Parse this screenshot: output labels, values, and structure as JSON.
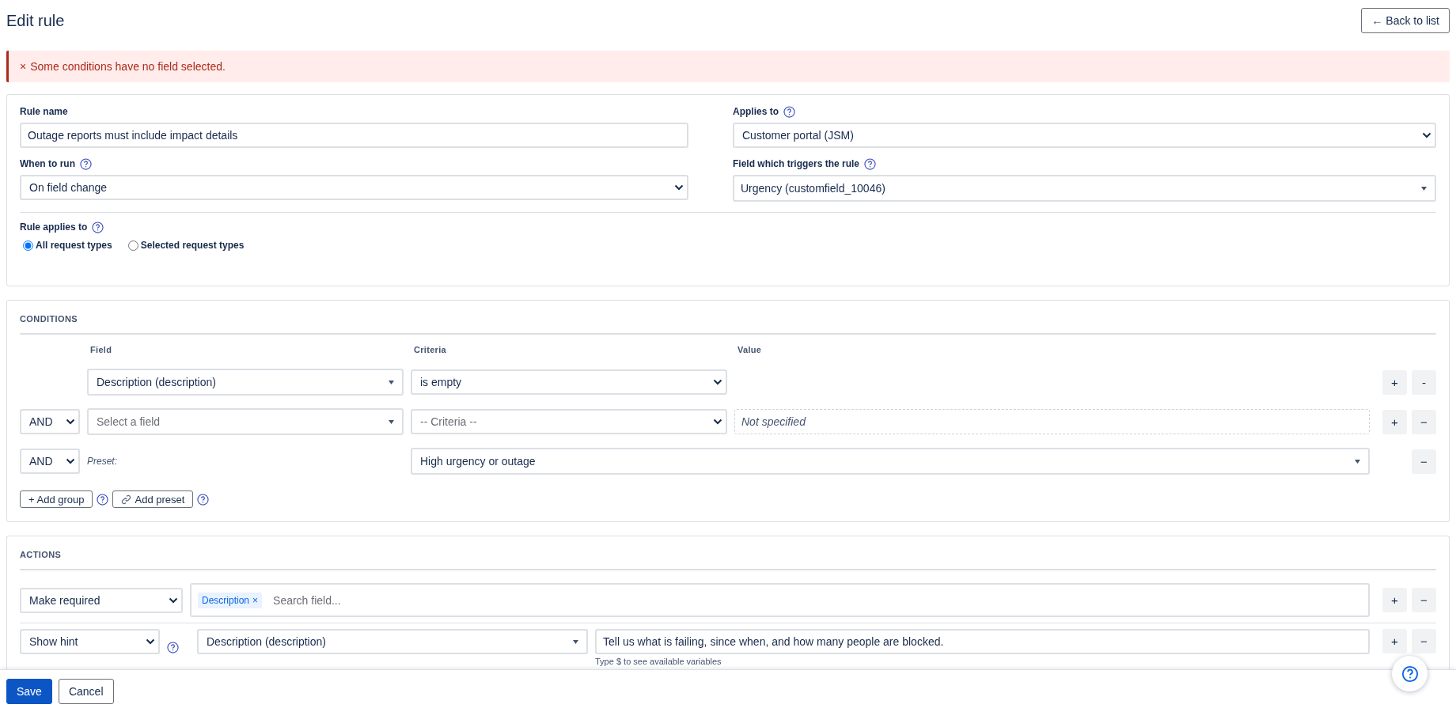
{
  "page": {
    "title": "Edit rule",
    "back_button": "← Back to list"
  },
  "error": {
    "icon": "×",
    "message": "Some conditions have no field selected."
  },
  "general": {
    "rule_name": {
      "label": "Rule name",
      "value": "Outage reports must include impact details"
    },
    "applies_to": {
      "label": "Applies to",
      "help": true,
      "kind": "select",
      "value": "Customer portal (JSM)"
    },
    "when_to_run": {
      "label": "When to run",
      "help": true,
      "kind": "select",
      "value": "On field change"
    },
    "trigger_field": {
      "label": "Field which triggers the rule",
      "help": true,
      "kind": "combo",
      "value": "Urgency (customfield_10046)"
    },
    "rule_applies_to": {
      "label": "Rule applies to",
      "help": true,
      "options": [
        {
          "label": "All request types",
          "selected": true
        },
        {
          "label": "Selected request types",
          "selected": false
        }
      ]
    }
  },
  "conditions": {
    "title": "CONDITIONS",
    "columns": [
      "Field",
      "Criteria",
      "Value"
    ],
    "rows": [
      {
        "kind": "condition",
        "field": "Description (description)",
        "criteria": "is empty",
        "buttons": [
          "+",
          "-"
        ]
      },
      {
        "kind": "condition",
        "operator": "AND",
        "field_placeholder": "Select a field",
        "criteria_placeholder": "-- Criteria --",
        "value_placeholder": "Not specified",
        "buttons": [
          "+",
          "−"
        ]
      },
      {
        "kind": "preset",
        "operator": "AND",
        "preset_label": "Preset:",
        "preset": "High urgency or outage",
        "buttons": [
          "−"
        ]
      }
    ],
    "buttons": [
      {
        "label": "+ Add group",
        "help": true
      },
      {
        "label": "Add preset",
        "help": true
      }
    ]
  },
  "actions": {
    "title": "ACTIONS",
    "rows": [
      {
        "kind": "fields",
        "action": "Make required",
        "tags": [
          {
            "label": "Description",
            "remove": "×"
          }
        ],
        "placeholder": "Search field...",
        "buttons": [
          "+",
          "−"
        ]
      },
      {
        "kind": "hint",
        "action": "Show hint",
        "help": true,
        "field": "Description (description)",
        "value": "Tell us what is failing, since when, and how many people are blocked.",
        "note": "Type $ to see available variables",
        "buttons": [
          "+",
          "−"
        ]
      }
    ]
  },
  "footer": {
    "buttons": [
      {
        "label": "Save",
        "kind": "primary"
      },
      {
        "label": "Cancel",
        "kind": "secondary"
      }
    ]
  }
}
